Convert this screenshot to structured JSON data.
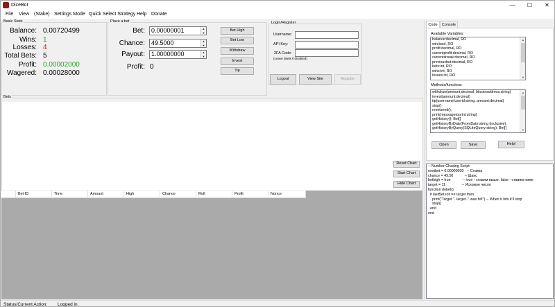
{
  "window": {
    "title": "DiceBot",
    "minimize": "—",
    "maximize": "☐",
    "close": "✕"
  },
  "menu": [
    "File",
    "View",
    "(Stake)",
    "Settings Mode",
    "Quick Select Strategy",
    "Help",
    "Donate"
  ],
  "basic_stats": {
    "title": "Basic Stats",
    "rows": [
      {
        "label": "Balance:",
        "value": "0.00720499",
        "color": "#000000"
      },
      {
        "label": "Wins:",
        "value": "1",
        "color": "#2e9e2e"
      },
      {
        "label": "Losses:",
        "value": "4",
        "color": "#d01010"
      },
      {
        "label": "Total Bets:",
        "value": "5",
        "color": "#000000"
      },
      {
        "label": "Profit:",
        "value": "0.00002000",
        "color": "#2e9e2e"
      },
      {
        "label": "Wagered:",
        "value": "0.00028000",
        "color": "#000000"
      }
    ]
  },
  "place_bet": {
    "title": "Place a bet",
    "bet_label": "Bet:",
    "bet_value": "0.00000001",
    "chance_label": "Chance:",
    "chance_value": "49.5000",
    "payout_label": "Payout:",
    "payout_value": "1.00000000",
    "profit_label": "Profit:",
    "profit_value": "0",
    "buttons": {
      "bet_high": "Bet High",
      "bet_low": "Bet Low",
      "withdraw": "Withdraw",
      "invest": "Invest",
      "tip": "Tip"
    }
  },
  "login": {
    "title": "Login/Register",
    "username_label": "Username:",
    "username_value": "",
    "apikey_label": "API Key:",
    "apikey_value": "",
    "twofa_label": "2FA Code:",
    "twofa_value": "",
    "twofa_hint": "(Leave blank if disabled)",
    "logout": "Logout",
    "view_site": "View Site",
    "register": "Register"
  },
  "bets": {
    "title": "Bets",
    "reset_chart": "Reset Chart",
    "start_chart": "Start Chart",
    "hide_chart": "Hide Chart",
    "columns": [
      "Bet ID",
      "Time",
      "Amount",
      "High",
      "Chance",
      "Roll",
      "Profit",
      "Nonce"
    ]
  },
  "right_panel": {
    "tabs": [
      "Code",
      "Console"
    ],
    "variables_label": "Available Variables:",
    "variables": [
      "balance:decimal, RO",
      "win:bool, RO",
      "profit:decimal, RO",
      "currentprofit:decimal, RO",
      "currentstreak:decimal, RO",
      "previousbet:decimal, RO",
      "bets:int, RO",
      "wins:int, RO",
      "losses:int, RO"
    ],
    "methods_label": "Methods/functions",
    "methods": [
      "withdraw(amount:decimal, bitcoinaddress:string)",
      "invest(amount:decimal)",
      "tip(username/userid:string, amount:decimal)",
      "stop()",
      "resetseed();",
      "print(messagetoprint:string)",
      "getHistory():  Bet[]",
      "getHistoryByDate(FromDate:string (inclusive),",
      "getHistoryByQuery(SQLiteQuery:string): Bet[]"
    ],
    "open": "Open",
    "save": "Save",
    "help": "Help!",
    "code_lines": [
      "-- Number Chasing Script",
      "nextbet = 0.00000000   -- Ставка",
      "chance = 49.50           -- Шанс",
      "bethigh = true            -- true - ставим выше, false - ставим ниже",
      "target = 11                -- Искомое число",
      "function dobet()",
      "  if lastBet.roll == target then",
      "    print(\"Target \"..target..\" was hit!\") -- When it hits it'll stop",
      "    stop()",
      "  end",
      "end"
    ]
  },
  "status": {
    "label": "Status/Current Action:",
    "value": "Logged in."
  },
  "colors": {
    "accent_blue": "#0078d7",
    "grid_bg": "#aaaaaa",
    "win_green": "#2e9e2e",
    "loss_red": "#d01010"
  }
}
